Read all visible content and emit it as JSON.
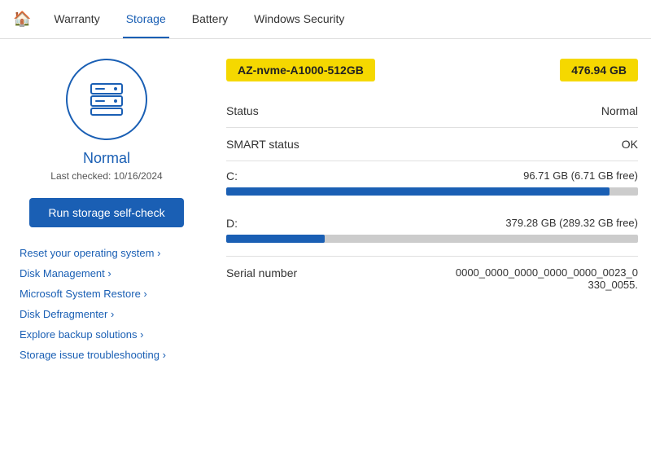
{
  "nav": {
    "home_icon": "⌂",
    "tabs": [
      {
        "label": "Warranty",
        "active": false
      },
      {
        "label": "Storage",
        "active": true
      },
      {
        "label": "Battery",
        "active": false
      },
      {
        "label": "Windows Security",
        "active": false
      }
    ]
  },
  "left": {
    "status": "Normal",
    "last_checked_label": "Last checked: 10/16/2024",
    "btn_label": "Run storage self-check",
    "links": [
      {
        "label": "Reset your operating system ›"
      },
      {
        "label": "Disk Management ›"
      },
      {
        "label": "Microsoft System Restore ›"
      },
      {
        "label": "Disk Defragmenter ›"
      },
      {
        "label": "Explore backup solutions ›"
      },
      {
        "label": "Storage issue troubleshooting ›"
      }
    ]
  },
  "right": {
    "drive_name": "AZ-nvme-A1000-512GB",
    "drive_size": "476.94 GB",
    "status_label": "Status",
    "status_value": "Normal",
    "smart_label": "SMART status",
    "smart_value": "OK",
    "c_drive_label": "C:",
    "c_drive_size": "96.71 GB (6.71 GB free)",
    "c_drive_used_pct": 93,
    "d_drive_label": "D:",
    "d_drive_size": "379.28 GB (289.32 GB free)",
    "d_drive_used_pct": 24,
    "serial_label": "Serial number",
    "serial_value_line1": "0000_0000_0000_0000_0000_0023_0",
    "serial_value_line2": "330_0055."
  },
  "colors": {
    "accent": "#1a5fb4",
    "yellow": "#f5d800"
  }
}
